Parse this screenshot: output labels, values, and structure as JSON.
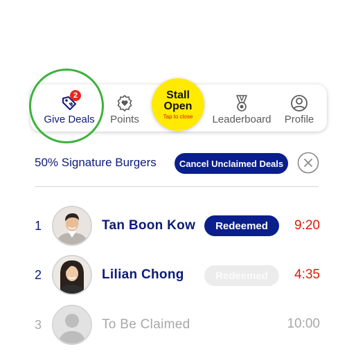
{
  "colors": {
    "navy": "#0a1f8c",
    "text_navy": "#0d1a78",
    "yellow": "#ffea00",
    "red": "#e3170a",
    "green": "#3db23d",
    "muted": "#a8a8a8"
  },
  "tabs": {
    "give_deals": {
      "label": "Give Deals",
      "icon": "tag-icon",
      "badge": "2"
    },
    "points": {
      "label": "Points",
      "icon": "heart-badge-icon"
    },
    "stall": {
      "line1": "Stall",
      "line2": "Open",
      "sub": "Tap to close"
    },
    "leaderboard": {
      "label": "Leaderboard",
      "icon": "medal-icon"
    },
    "profile": {
      "label": "Profile",
      "icon": "user-circle-icon"
    }
  },
  "deal": {
    "title": "50% Signature Burgers",
    "cancel_label": "Cancel Unclaimed Deals",
    "close_icon": "close-circle-icon"
  },
  "rows": [
    {
      "num": "1",
      "name": "Tan Boon Kow",
      "status": "Redeemed",
      "time": "9:20"
    },
    {
      "num": "2",
      "name": "Lilian Chong",
      "status": "Redeemed",
      "time": "4:35"
    },
    {
      "num": "3",
      "name": "To Be Claimed",
      "status": "",
      "time": "10:00"
    }
  ]
}
